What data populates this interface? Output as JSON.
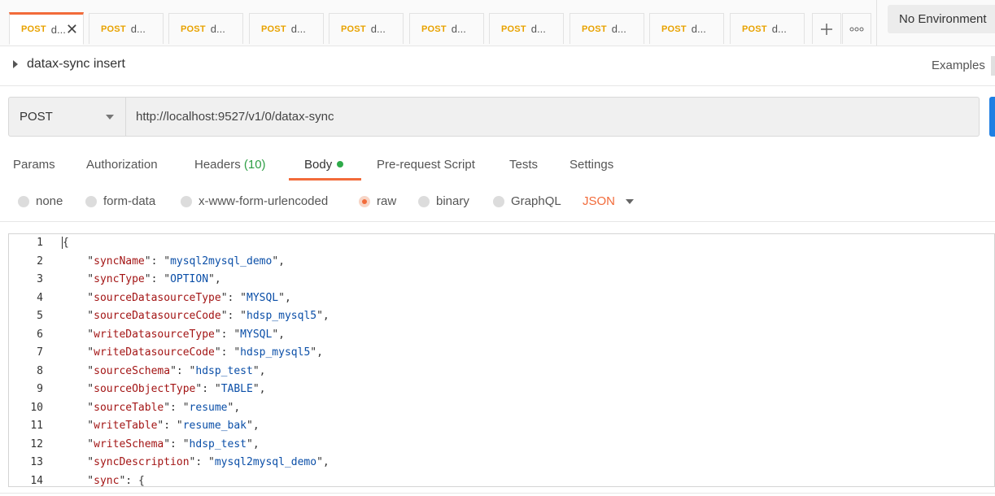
{
  "tabs": [
    {
      "method": "POST",
      "name": "d...",
      "active": true
    },
    {
      "method": "POST",
      "name": "d..."
    },
    {
      "method": "POST",
      "name": "d..."
    },
    {
      "method": "POST",
      "name": "d..."
    },
    {
      "method": "POST",
      "name": "d..."
    },
    {
      "method": "POST",
      "name": "d..."
    },
    {
      "method": "POST",
      "name": "d..."
    },
    {
      "method": "POST",
      "name": "d..."
    },
    {
      "method": "POST",
      "name": "d..."
    },
    {
      "method": "POST",
      "name": "d..."
    }
  ],
  "tab_actions": {
    "add_icon": "plus-icon",
    "more_icon": "more-icon"
  },
  "environment": {
    "label": "No Environment"
  },
  "request": {
    "title": "datax-sync insert",
    "examples_label": "Examples",
    "method": "POST",
    "url": "http://localhost:9527/v1/0/datax-sync"
  },
  "subtabs": {
    "params": "Params",
    "authorization": "Authorization",
    "headers": "Headers",
    "headers_count": "(10)",
    "body": "Body",
    "pre_request": "Pre-request Script",
    "tests": "Tests",
    "settings": "Settings"
  },
  "body_types": {
    "none": "none",
    "form_data": "form-data",
    "urlencoded": "x-www-form-urlencoded",
    "raw": "raw",
    "binary": "binary",
    "graphql": "GraphQL",
    "selected": "raw",
    "format": "JSON"
  },
  "colors": {
    "accent": "#f26b3a",
    "method": "#e8a200",
    "key": "#a31515",
    "string": "#0b4fa8",
    "send": "#1f7fe3"
  },
  "editor": {
    "line_numbers": [
      "1",
      "2",
      "3",
      "4",
      "5",
      "6",
      "7",
      "8",
      "9",
      "10",
      "11",
      "12",
      "13",
      "14"
    ],
    "lines": [
      {
        "text": "{"
      },
      {
        "key": "syncName",
        "value": "mysql2mysql_demo"
      },
      {
        "key": "syncType",
        "value": "OPTION"
      },
      {
        "key": "sourceDatasourceType",
        "value": "MYSQL"
      },
      {
        "key": "sourceDatasourceCode",
        "value": "hdsp_mysql5"
      },
      {
        "key": "writeDatasourceType",
        "value": "MYSQL"
      },
      {
        "key": "writeDatasourceCode",
        "value": "hdsp_mysql5"
      },
      {
        "key": "sourceSchema",
        "value": "hdsp_test"
      },
      {
        "key": "sourceObjectType",
        "value": "TABLE"
      },
      {
        "key": "sourceTable",
        "value": "resume"
      },
      {
        "key": "writeTable",
        "value": "resume_bak"
      },
      {
        "key": "writeSchema",
        "value": "hdsp_test"
      },
      {
        "key": "syncDescription",
        "value": "mysql2mysql_demo"
      },
      {
        "key": "sync",
        "open": "{"
      }
    ]
  }
}
